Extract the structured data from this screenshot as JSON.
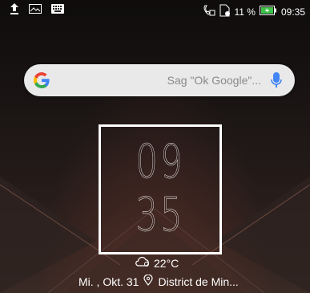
{
  "status_bar": {
    "left_icons": [
      "upload-icon",
      "image-icon",
      "keyboard-icon"
    ],
    "right_icons": [
      "call-icon",
      "sim-icon"
    ],
    "battery_percent": "11 %",
    "time": "09:35"
  },
  "search": {
    "placeholder": "Sag \"Ok Google\"...",
    "logo": "google-g-icon",
    "mic": "mic-icon"
  },
  "clock": {
    "hours": "09",
    "minutes": "35"
  },
  "weather": {
    "icon": "cloud-icon",
    "temperature": "22°C"
  },
  "date_location": {
    "date": "Mi. , Okt. 31",
    "location": "District de Min..."
  },
  "colors": {
    "accent_battery": "#3fc24a",
    "mic": "#4285f4"
  }
}
